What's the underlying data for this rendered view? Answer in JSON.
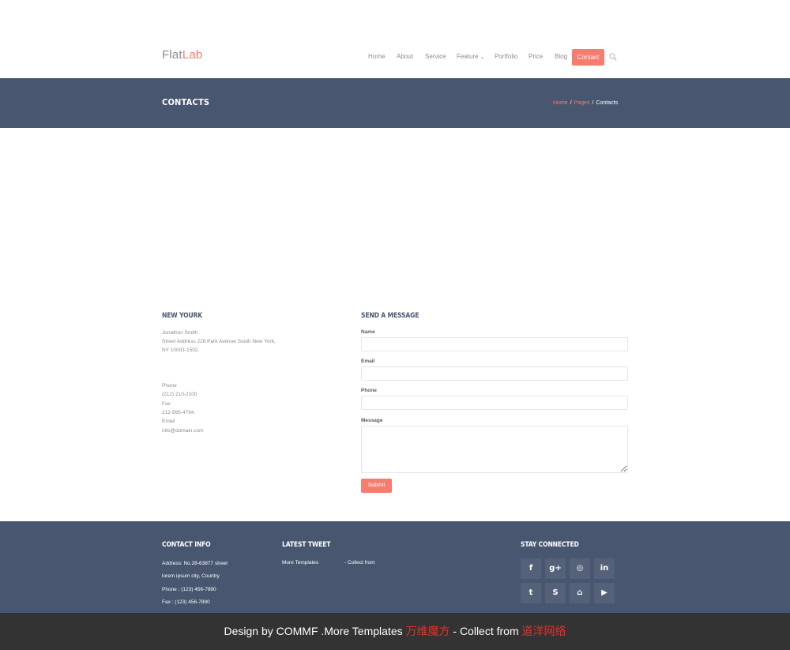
{
  "header": {
    "logo_main": "Flat",
    "logo_accent": "Lab",
    "nav": [
      "Home",
      "About",
      "Service",
      "Feature",
      "Portfolio",
      "Price",
      "Blog"
    ],
    "nav_caret": "⌄",
    "nav_active": "Contact"
  },
  "band": {
    "title": "CONTACTS",
    "crumbs": [
      "Home",
      "Pages",
      "Contacts"
    ],
    "sep": "/"
  },
  "contact": {
    "title": "NEW YOURK",
    "name": "Jonathon Smith",
    "address1": "Street Address 228 Park Avenue South New York,",
    "address2": "NY 10003-1502.",
    "phone_label": "Phone",
    "phone": "(212) 210-2100",
    "fax_label": "Fax",
    "fax": "212-995-4794.",
    "email_label": "Email",
    "email": "info@domain.com"
  },
  "form": {
    "title": "SEND A MESSAGE",
    "name_label": "Name",
    "email_label": "Email",
    "phone_label": "Phone",
    "message_label": "Message",
    "submit": "Submit"
  },
  "footer": {
    "contact_title": "CONTACT INFO",
    "address": "Address: No.28-63877 street",
    "city": "lorem ipsum city, Country",
    "phone": "Phone : (123) 456-7890",
    "fax": "Fax : (123) 456-7890",
    "tweet_title": "LATEST TWEET",
    "tweet_left": "More Templates",
    "tweet_right": "- Collect from",
    "stay_title": "STAY CONNECTED",
    "social": [
      "f",
      "g+",
      "◎",
      "in",
      "t",
      "S",
      "⌂",
      "▶"
    ]
  },
  "credit": {
    "prefix": "Design by COMMF .More Templates ",
    "brand1": "万维魔方",
    "middle": " - Collect from ",
    "brand2": "道洋网络"
  },
  "colors": {
    "accent": "#f77b6f",
    "band": "#48566f",
    "credit_bg": "#333333",
    "credit_red": "#e3312b"
  }
}
